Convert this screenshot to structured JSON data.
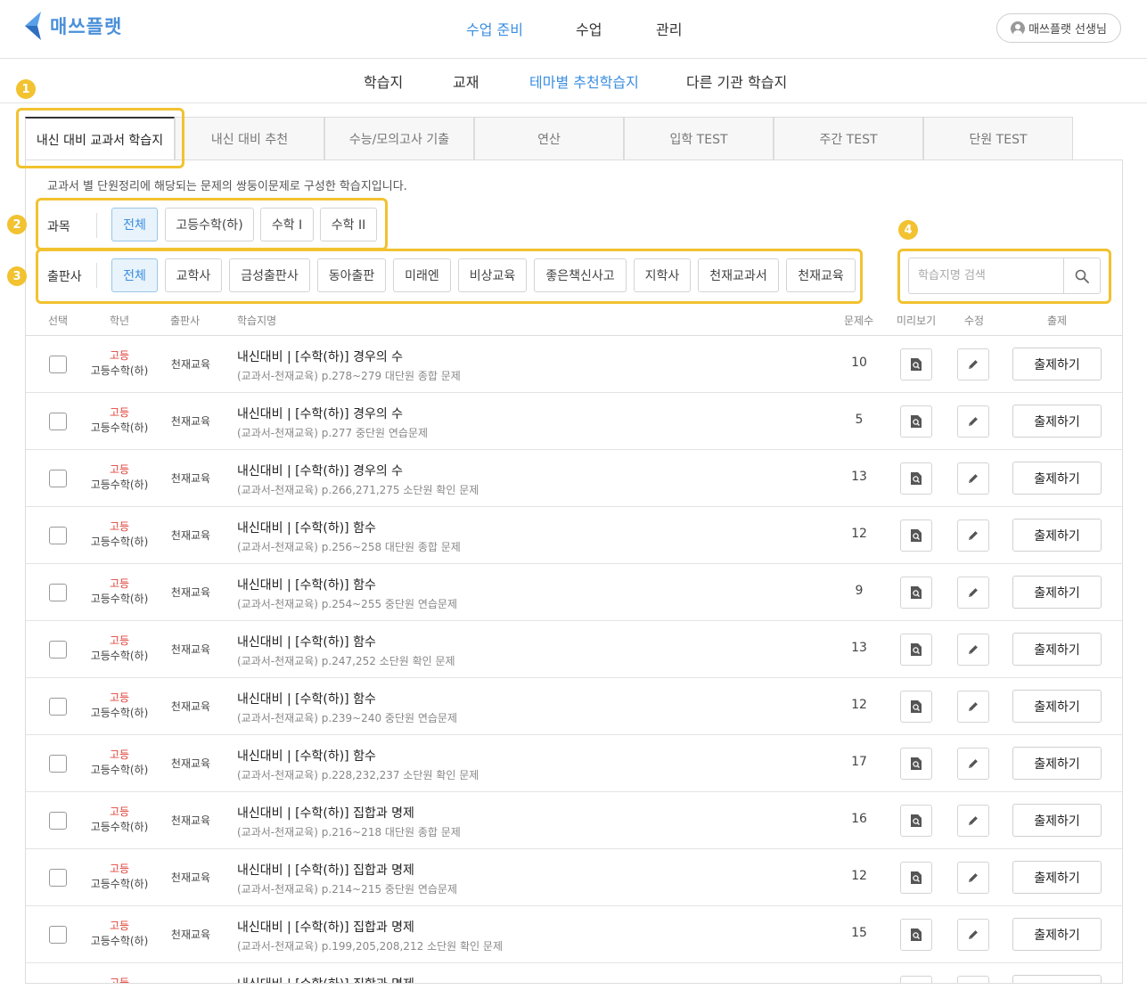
{
  "brand": {
    "name": "매쓰플랫"
  },
  "main_nav": [
    {
      "label": "수업 준비",
      "active": true
    },
    {
      "label": "수업",
      "active": false
    },
    {
      "label": "관리",
      "active": false
    }
  ],
  "user": {
    "label": "매쓰플랫 선생님"
  },
  "sub_nav": [
    {
      "label": "학습지",
      "active": false
    },
    {
      "label": "교재",
      "active": false
    },
    {
      "label": "테마별 추천학습지",
      "active": true
    },
    {
      "label": "다른 기관 학습지",
      "active": false
    }
  ],
  "callouts": [
    "1",
    "2",
    "3",
    "4"
  ],
  "tabs": [
    {
      "label": "내신 대비 교과서 학습지",
      "active": true
    },
    {
      "label": "내신 대비 추천",
      "active": false
    },
    {
      "label": "수능/모의고사 기출",
      "active": false
    },
    {
      "label": "연산",
      "active": false
    },
    {
      "label": "입학 TEST",
      "active": false
    },
    {
      "label": "주간 TEST",
      "active": false
    },
    {
      "label": "단원 TEST",
      "active": false
    }
  ],
  "description": "교과서 별 단원정리에 해당되는 문제의 쌍둥이문제로 구성한 학습지입니다.",
  "subject_filter": {
    "label": "과목",
    "options": [
      {
        "label": "전체",
        "active": true
      },
      {
        "label": "고등수학(하)",
        "active": false
      },
      {
        "label": "수학 I",
        "active": false
      },
      {
        "label": "수학 II",
        "active": false
      }
    ]
  },
  "publisher_filter": {
    "label": "출판사",
    "options": [
      {
        "label": "전체",
        "active": true
      },
      {
        "label": "교학사",
        "active": false
      },
      {
        "label": "금성출판사",
        "active": false
      },
      {
        "label": "동아출판",
        "active": false
      },
      {
        "label": "미래엔",
        "active": false
      },
      {
        "label": "비상교육",
        "active": false
      },
      {
        "label": "좋은책신사고",
        "active": false
      },
      {
        "label": "지학사",
        "active": false
      },
      {
        "label": "천재교과서",
        "active": false
      },
      {
        "label": "천재교육",
        "active": false
      }
    ]
  },
  "search": {
    "placeholder": "학습지명 검색",
    "value": ""
  },
  "table": {
    "headers": {
      "select": "선택",
      "grade": "학년",
      "publisher": "출판사",
      "name": "학습지명",
      "count": "문제수",
      "preview": "미리보기",
      "edit": "수정",
      "assign": "출제"
    },
    "assign_label": "출제하기",
    "rows": [
      {
        "level": "고등",
        "course": "고등수학(하)",
        "publisher": "천재교육",
        "title": "내신대비 | [수학(하)] 경우의 수",
        "subtitle": "(교과서-천재교육) p.278~279 대단원 종합 문제",
        "count": "10"
      },
      {
        "level": "고등",
        "course": "고등수학(하)",
        "publisher": "천재교육",
        "title": "내신대비 | [수학(하)] 경우의 수",
        "subtitle": "(교과서-천재교육) p.277 중단원 연습문제",
        "count": "5"
      },
      {
        "level": "고등",
        "course": "고등수학(하)",
        "publisher": "천재교육",
        "title": "내신대비 | [수학(하)] 경우의 수",
        "subtitle": "(교과서-천재교육) p.266,271,275 소단원 확인 문제",
        "count": "13"
      },
      {
        "level": "고등",
        "course": "고등수학(하)",
        "publisher": "천재교육",
        "title": "내신대비 | [수학(하)] 함수",
        "subtitle": "(교과서-천재교육) p.256~258 대단원 종합 문제",
        "count": "12"
      },
      {
        "level": "고등",
        "course": "고등수학(하)",
        "publisher": "천재교육",
        "title": "내신대비 | [수학(하)] 함수",
        "subtitle": "(교과서-천재교육) p.254~255 중단원 연습문제",
        "count": "9"
      },
      {
        "level": "고등",
        "course": "고등수학(하)",
        "publisher": "천재교육",
        "title": "내신대비 | [수학(하)] 함수",
        "subtitle": "(교과서-천재교육) p.247,252 소단원 확인 문제",
        "count": "13"
      },
      {
        "level": "고등",
        "course": "고등수학(하)",
        "publisher": "천재교육",
        "title": "내신대비 | [수학(하)] 함수",
        "subtitle": "(교과서-천재교육) p.239~240 중단원 연습문제",
        "count": "12"
      },
      {
        "level": "고등",
        "course": "고등수학(하)",
        "publisher": "천재교육",
        "title": "내신대비 | [수학(하)] 함수",
        "subtitle": "(교과서-천재교육) p.228,232,237 소단원 확인 문제",
        "count": "17"
      },
      {
        "level": "고등",
        "course": "고등수학(하)",
        "publisher": "천재교육",
        "title": "내신대비 | [수학(하)] 집합과 명제",
        "subtitle": "(교과서-천재교육) p.216~218 대단원 종합 문제",
        "count": "16"
      },
      {
        "level": "고등",
        "course": "고등수학(하)",
        "publisher": "천재교육",
        "title": "내신대비 | [수학(하)] 집합과 명제",
        "subtitle": "(교과서-천재교육) p.214~215 중단원 연습문제",
        "count": "12"
      },
      {
        "level": "고등",
        "course": "고등수학(하)",
        "publisher": "천재교육",
        "title": "내신대비 | [수학(하)] 집합과 명제",
        "subtitle": "(교과서-천재교육) p.199,205,208,212 소단원 확인 문제",
        "count": "15"
      },
      {
        "level": "고등",
        "course": "",
        "publisher": "",
        "title": "내신대비 | [수학(하)] 집합과 명제",
        "subtitle": "",
        "count": ""
      }
    ]
  },
  "colors": {
    "accent": "#3b8ee0",
    "highlight": "#f2c230",
    "grade_red": "#e0463d"
  }
}
